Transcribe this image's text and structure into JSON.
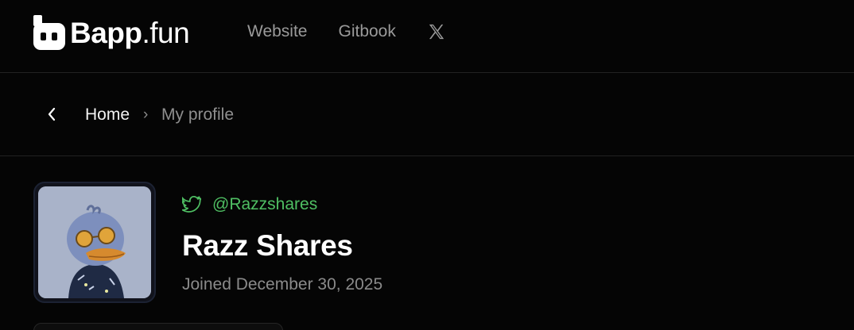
{
  "brand": {
    "name_bold": "Bapp",
    "name_rest": ".fun"
  },
  "nav": {
    "website": "Website",
    "gitbook": "Gitbook",
    "x_icon": "x-logo-icon"
  },
  "breadcrumb": {
    "back_icon": "chevron-left-icon",
    "home": "Home",
    "separator": "›",
    "current": "My profile"
  },
  "profile": {
    "twitter_icon": "twitter-bird-icon",
    "handle": "@Razzshares",
    "display_name": "Razz Shares",
    "joined": "Joined December 30, 2025",
    "handle_color": "#4fbf63"
  },
  "colors": {
    "background": "#050505",
    "divider": "#222222",
    "muted_text": "#8a8a8a"
  }
}
